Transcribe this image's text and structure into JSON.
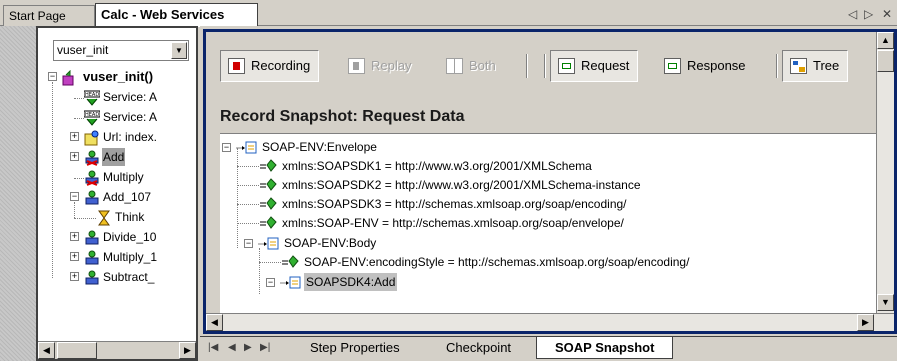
{
  "tabs": [
    {
      "label": "Start Page",
      "active": false
    },
    {
      "label": "Calc - Web Services",
      "active": true
    }
  ],
  "tab_nav": {
    "prev": "◁",
    "next": "▷",
    "close": "✕"
  },
  "left": {
    "combo_value": "vuser_init",
    "tree": [
      {
        "label": "vuser_init()",
        "icon": "action-icon",
        "expander": "-",
        "bold": true
      },
      {
        "label": "Service: A",
        "icon": "header-icon"
      },
      {
        "label": "Service: A",
        "icon": "header-icon"
      },
      {
        "label": "Url: index.",
        "icon": "url-icon",
        "expander": "+"
      },
      {
        "label": "Add",
        "icon": "web-service-error-icon",
        "expander": "+",
        "selected": true
      },
      {
        "label": "Multiply",
        "icon": "web-service-error-icon"
      },
      {
        "label": "Add_107",
        "icon": "web-service-icon",
        "expander": "-"
      },
      {
        "label": "Think",
        "icon": "hourglass-icon"
      },
      {
        "label": "Divide_10",
        "icon": "web-service-icon",
        "expander": "+"
      },
      {
        "label": "Multiply_1",
        "icon": "web-service-icon",
        "expander": "+"
      },
      {
        "label": "Subtract_",
        "icon": "web-service-icon",
        "expander": "+"
      }
    ]
  },
  "toolbar": {
    "recording": "Recording",
    "replay": "Replay",
    "both": "Both",
    "request": "Request",
    "response": "Response",
    "tree": "Tree"
  },
  "snapshot_title": "Record Snapshot: Request Data",
  "xml_tree": [
    {
      "label": "SOAP-ENV:Envelope",
      "kind": "element",
      "expander": "-"
    },
    {
      "label": "xmlns:SOAPSDK1 = http://www.w3.org/2001/XMLSchema",
      "kind": "attribute"
    },
    {
      "label": "xmlns:SOAPSDK2 = http://www.w3.org/2001/XMLSchema-instance",
      "kind": "attribute"
    },
    {
      "label": "xmlns:SOAPSDK3 = http://schemas.xmlsoap.org/soap/encoding/",
      "kind": "attribute"
    },
    {
      "label": "xmlns:SOAP-ENV = http://schemas.xmlsoap.org/soap/envelope/",
      "kind": "attribute"
    },
    {
      "label": "SOAP-ENV:Body",
      "kind": "element",
      "expander": "-"
    },
    {
      "label": "SOAP-ENV:encodingStyle = http://schemas.xmlsoap.org/soap/encoding/",
      "kind": "attribute"
    },
    {
      "label": "SOAPSDK4:Add",
      "kind": "element",
      "expander": "-",
      "selected": true
    }
  ],
  "bottom_tabs": [
    {
      "label": "Step Properties",
      "active": false
    },
    {
      "label": "Checkpoint",
      "active": false
    },
    {
      "label": "SOAP Snapshot",
      "active": true
    }
  ],
  "bottom_nav": [
    "|◀",
    "◀",
    "▶",
    "▶|"
  ],
  "colors": {
    "focus_frame": "#0a246a",
    "selection": "#c0c0c0",
    "panel": "#d4d0c8"
  }
}
